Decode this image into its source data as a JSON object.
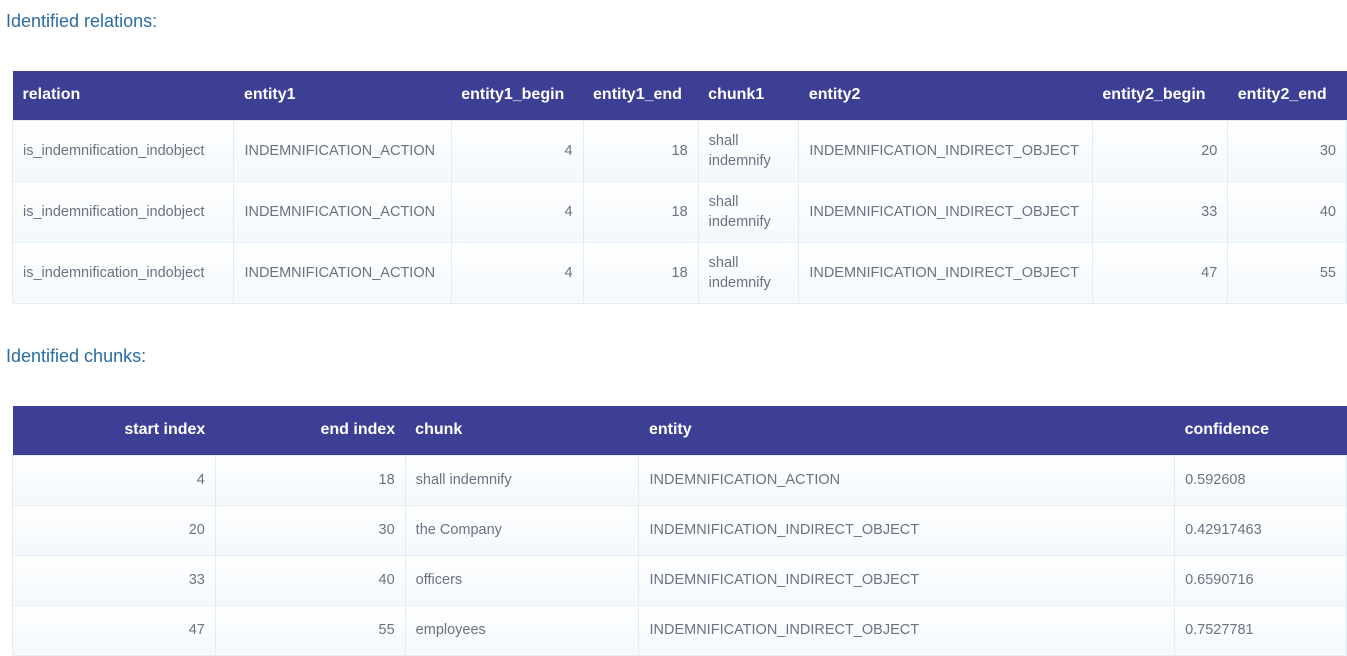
{
  "relations": {
    "title": "Identified relations:",
    "columns": [
      "relation",
      "entity1",
      "entity1_begin",
      "entity1_end",
      "chunk1",
      "entity2",
      "entity2_begin",
      "entity2_end"
    ],
    "rows": [
      [
        "is_indemnification_indobject",
        "INDEMNIFICATION_ACTION",
        "4",
        "18",
        "shall indemnify",
        "INDEMNIFICATION_INDIRECT_OBJECT",
        "20",
        "30"
      ],
      [
        "is_indemnification_indobject",
        "INDEMNIFICATION_ACTION",
        "4",
        "18",
        "shall indemnify",
        "INDEMNIFICATION_INDIRECT_OBJECT",
        "33",
        "40"
      ],
      [
        "is_indemnification_indobject",
        "INDEMNIFICATION_ACTION",
        "4",
        "18",
        "shall indemnify",
        "INDEMNIFICATION_INDIRECT_OBJECT",
        "47",
        "55"
      ]
    ]
  },
  "chunks": {
    "title": "Identified chunks:",
    "columns": [
      "start index",
      "end index",
      "chunk",
      "entity",
      "confidence"
    ],
    "rows": [
      [
        "4",
        "18",
        "shall indemnify",
        "INDEMNIFICATION_ACTION",
        "0.592608"
      ],
      [
        "20",
        "30",
        "the Company",
        "INDEMNIFICATION_INDIRECT_OBJECT",
        "0.42917463"
      ],
      [
        "33",
        "40",
        "officers",
        "INDEMNIFICATION_INDIRECT_OBJECT",
        "0.6590716"
      ],
      [
        "47",
        "55",
        "employees",
        "INDEMNIFICATION_INDIRECT_OBJECT",
        "0.7527781"
      ]
    ]
  }
}
